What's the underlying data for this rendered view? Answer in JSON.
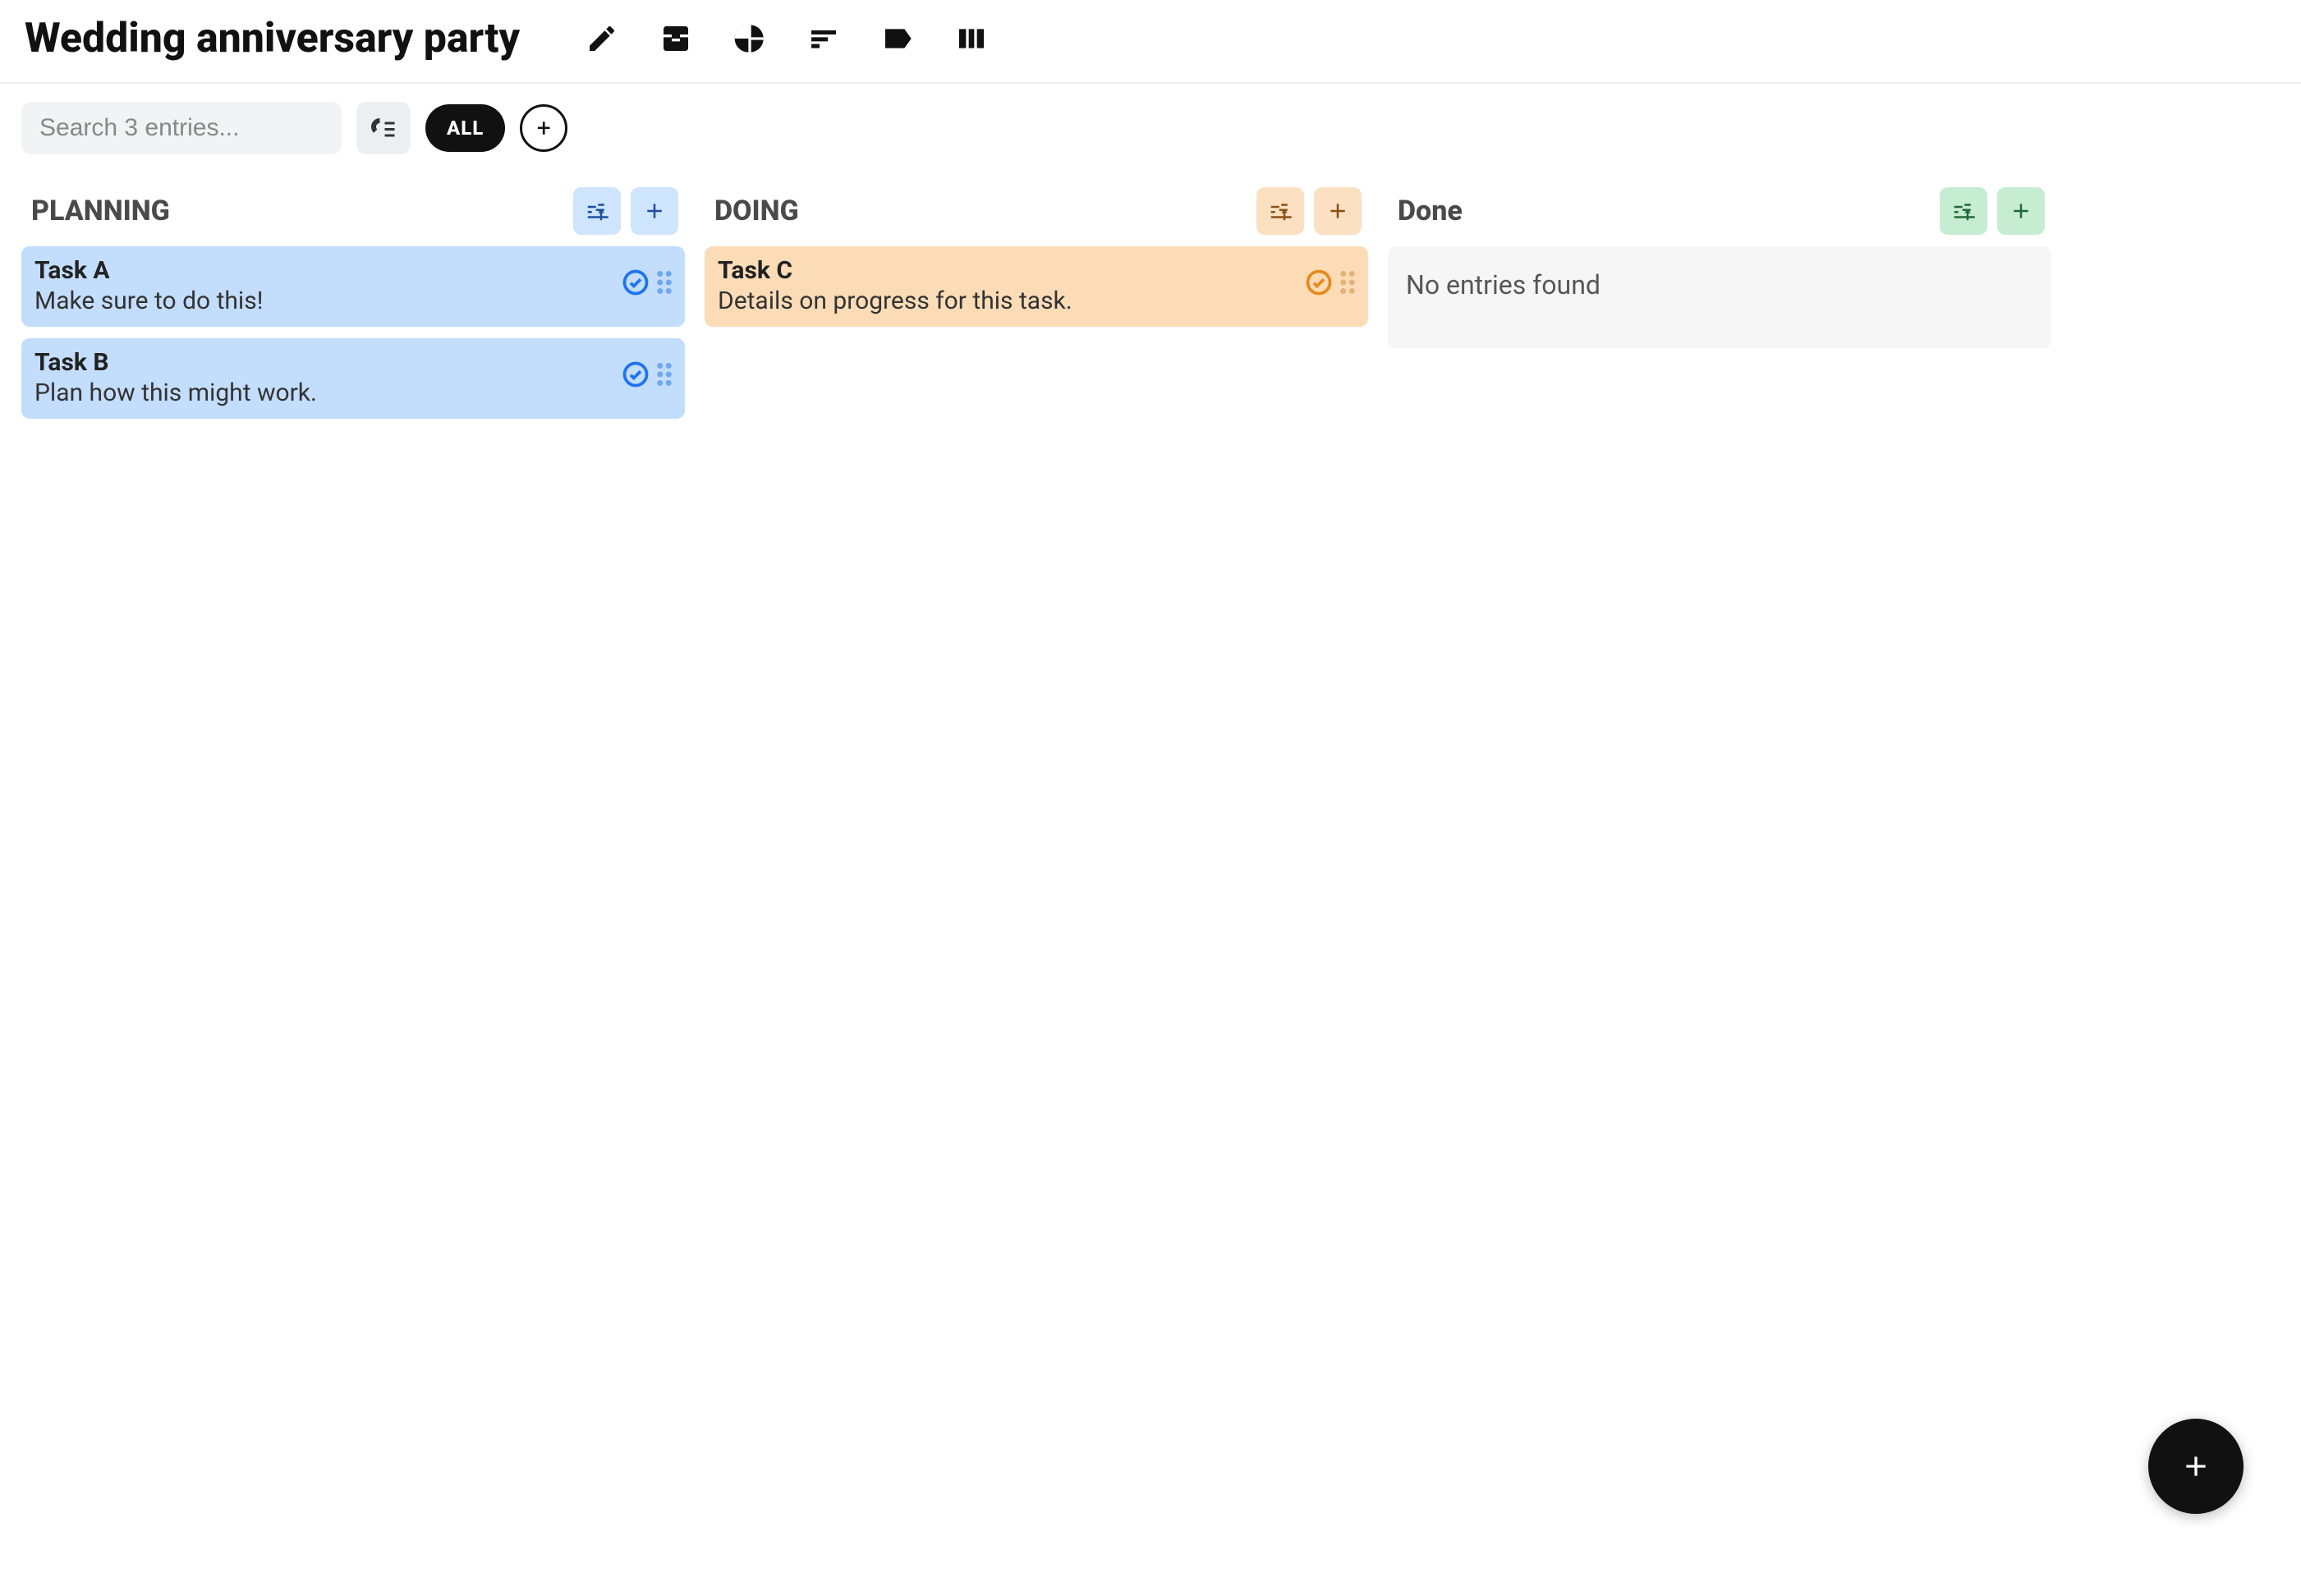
{
  "header": {
    "title": "Wedding anniversary party",
    "icons": [
      "edit",
      "inbox",
      "chart",
      "sort",
      "tag",
      "columns"
    ]
  },
  "toolbar": {
    "search_placeholder": "Search 3 entries...",
    "filter_all_label": "ALL"
  },
  "columns": [
    {
      "id": "planning",
      "title": "PLANNING",
      "accent": "blue",
      "cards": [
        {
          "title": "Task A",
          "desc": "Make sure to do this!"
        },
        {
          "title": "Task B",
          "desc": "Plan how this might work."
        }
      ],
      "empty": null
    },
    {
      "id": "doing",
      "title": "DOING",
      "accent": "orange",
      "cards": [
        {
          "title": "Task C",
          "desc": "Details on progress for this task."
        }
      ],
      "empty": null
    },
    {
      "id": "done",
      "title": "Done",
      "accent": "green",
      "cards": [],
      "empty": "No entries found"
    }
  ]
}
